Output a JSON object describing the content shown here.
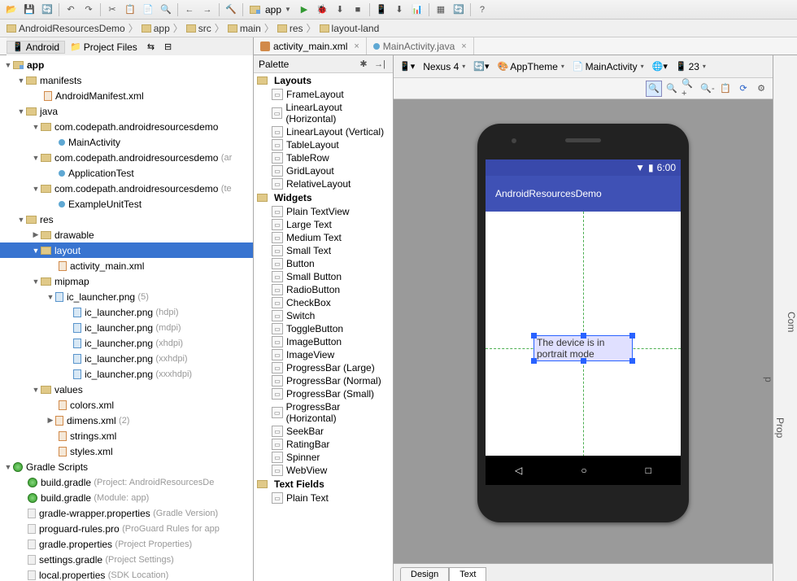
{
  "toolbar": {
    "module": "app"
  },
  "breadcrumbs": [
    "AndroidResourcesDemo",
    "app",
    "src",
    "main",
    "res",
    "layout-land"
  ],
  "view_selector": {
    "android": "Android",
    "project_files": "Project Files"
  },
  "tree": {
    "app": "app",
    "manifests": "manifests",
    "am": "AndroidManifest.xml",
    "java": "java",
    "pkg1": "com.codepath.androidresourcesdemo",
    "mainact": "MainActivity",
    "pkg2": "com.codepath.androidresourcesdemo",
    "pkg2_note": "(ar",
    "apptest": "ApplicationTest",
    "pkg3": "com.codepath.androidresourcesdemo",
    "pkg3_note": "(te",
    "unittest": "ExampleUnitTest",
    "res": "res",
    "drawable": "drawable",
    "layout": "layout",
    "act_main": "activity_main.xml",
    "mipmap": "mipmap",
    "ic_launcher": "ic_launcher.png",
    "ic_count": "(5)",
    "ic_hdpi": "ic_launcher.png",
    "ic_hdpi_note": "(hdpi)",
    "ic_mdpi": "ic_launcher.png",
    "ic_mdpi_note": "(mdpi)",
    "ic_xhdpi": "ic_launcher.png",
    "ic_xhdpi_note": "(xhdpi)",
    "ic_xxhdpi": "ic_launcher.png",
    "ic_xxhdpi_note": "(xxhdpi)",
    "ic_xxxhdpi": "ic_launcher.png",
    "ic_xxxhdpi_note": "(xxxhdpi)",
    "values": "values",
    "colors": "colors.xml",
    "dimens": "dimens.xml",
    "dimens_note": "(2)",
    "strings": "strings.xml",
    "styles": "styles.xml",
    "gradle_scripts": "Gradle Scripts",
    "bg1": "build.gradle",
    "bg1_note": "(Project: AndroidResourcesDe",
    "bg2": "build.gradle",
    "bg2_note": "(Module: app)",
    "gwp": "gradle-wrapper.properties",
    "gwp_note": "(Gradle Version)",
    "proguard": "proguard-rules.pro",
    "proguard_note": "(ProGuard Rules for app",
    "gp": "gradle.properties",
    "gp_note": "(Project Properties)",
    "sg": "settings.gradle",
    "sg_note": "(Project Settings)",
    "lp": "local.properties",
    "lp_note": "(SDK Location)"
  },
  "editor_tabs": {
    "t1": "activity_main.xml",
    "t2": "MainActivity.java"
  },
  "palette": {
    "title": "Palette",
    "layouts": "Layouts",
    "items_layout": [
      "FrameLayout",
      "LinearLayout (Horizontal)",
      "LinearLayout (Vertical)",
      "TableLayout",
      "TableRow",
      "GridLayout",
      "RelativeLayout"
    ],
    "widgets": "Widgets",
    "items_widgets": [
      "Plain TextView",
      "Large Text",
      "Medium Text",
      "Small Text",
      "Button",
      "Small Button",
      "RadioButton",
      "CheckBox",
      "Switch",
      "ToggleButton",
      "ImageButton",
      "ImageView",
      "ProgressBar (Large)",
      "ProgressBar (Normal)",
      "ProgressBar (Small)",
      "ProgressBar (Horizontal)",
      "SeekBar",
      "RatingBar",
      "Spinner",
      "WebView"
    ],
    "textfields": "Text Fields",
    "items_tf": [
      "Plain Text"
    ]
  },
  "designer_toolbar": {
    "device": "Nexus 4",
    "theme": "AppTheme",
    "activity": "MainActivity",
    "api": "23"
  },
  "preview": {
    "time": "6:00",
    "app_title": "AndroidResourcesDemo",
    "textview": "The device is in portrait mode"
  },
  "rightpanel": {
    "com": "Com",
    "prop": "Prop",
    "p": "p"
  },
  "bottom_tabs": {
    "design": "Design",
    "text": "Text"
  }
}
